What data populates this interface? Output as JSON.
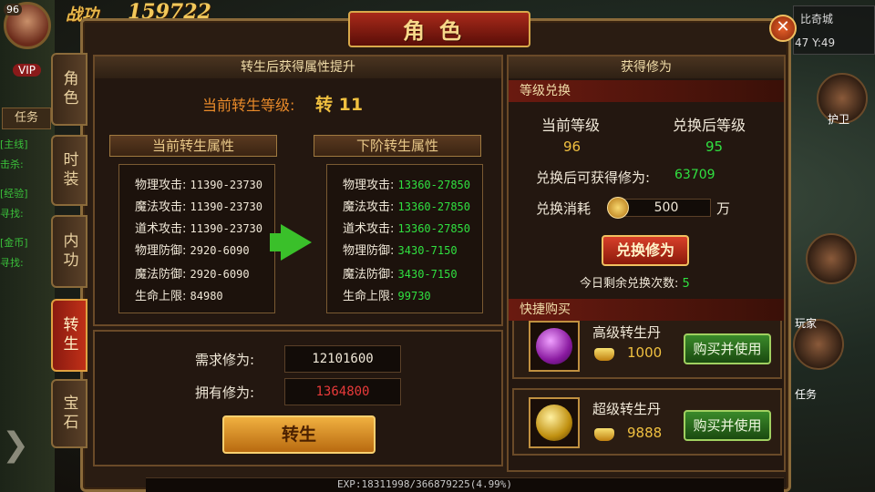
{
  "hud": {
    "level": "96",
    "power_label": "战功",
    "power_value": "159722",
    "vip": "VIP",
    "task_button": "任务",
    "side_lines": [
      "[主线]",
      "击杀:",
      "[经验]",
      "寻找:",
      "[金币]",
      "寻找:"
    ],
    "map_name": "比奇城",
    "coords": "47 Y:49",
    "right_buttons": [
      "护卫",
      "玩家",
      "任务"
    ]
  },
  "window": {
    "title": "角色"
  },
  "tabs": [
    {
      "label": "角色",
      "active": false
    },
    {
      "label": "时装",
      "active": false
    },
    {
      "label": "内功",
      "active": false
    },
    {
      "label": "转生",
      "active": true
    },
    {
      "label": "宝石",
      "active": false
    }
  ],
  "rebirth": {
    "header": "转生后获得属性提升",
    "current_level_label": "当前转生等级:",
    "current_level_value": "转 11",
    "current_banner": "当前转生属性",
    "next_banner": "下阶转生属性",
    "current_attrs": [
      {
        "name": "物理攻击:",
        "value": "11390-23730"
      },
      {
        "name": "魔法攻击:",
        "value": "11390-23730"
      },
      {
        "name": "道术攻击:",
        "value": "11390-23730"
      },
      {
        "name": "物理防御:",
        "value": "2920-6090"
      },
      {
        "name": "魔法防御:",
        "value": "2920-6090"
      },
      {
        "name": "生命上限:",
        "value": "84980"
      }
    ],
    "next_attrs": [
      {
        "name": "物理攻击:",
        "value": "13360-27850"
      },
      {
        "name": "魔法攻击:",
        "value": "13360-27850"
      },
      {
        "name": "道术攻击:",
        "value": "13360-27850"
      },
      {
        "name": "物理防御:",
        "value": "3430-7150"
      },
      {
        "name": "魔法防御:",
        "value": "3430-7150"
      },
      {
        "name": "生命上限:",
        "value": "99730"
      }
    ],
    "required_label": "需求修为:",
    "required_value": "12101600",
    "owned_label": "拥有修为:",
    "owned_value": "1364800",
    "rebirth_button": "转生"
  },
  "cultivation": {
    "header": "获得修为",
    "exchange_section": "等级兑换",
    "current_level_label": "当前等级",
    "current_level_value": "96",
    "after_level_label": "兑换后等级",
    "after_level_value": "95",
    "gain_label": "兑换后可获得修为:",
    "gain_value": "63709",
    "cost_label": "兑换消耗",
    "cost_value": "500",
    "cost_unit": "万",
    "exchange_button": "兑换修为",
    "remaining_label": "今日剩余兑换次数:",
    "remaining_value": "5",
    "quick_buy_section": "快捷购买",
    "items": [
      {
        "name": "高级转生丹",
        "price": "1000",
        "button": "购买并使用"
      },
      {
        "name": "超级转生丹",
        "price": "9888",
        "button": "购买并使用"
      }
    ]
  },
  "exp": {
    "text": "EXP:18311998/366879225(4.99%)"
  },
  "colors": {
    "accent_red": "#8a1a10",
    "gold": "#f0c040",
    "green": "#30e040",
    "red_value": "#e83a3a"
  }
}
